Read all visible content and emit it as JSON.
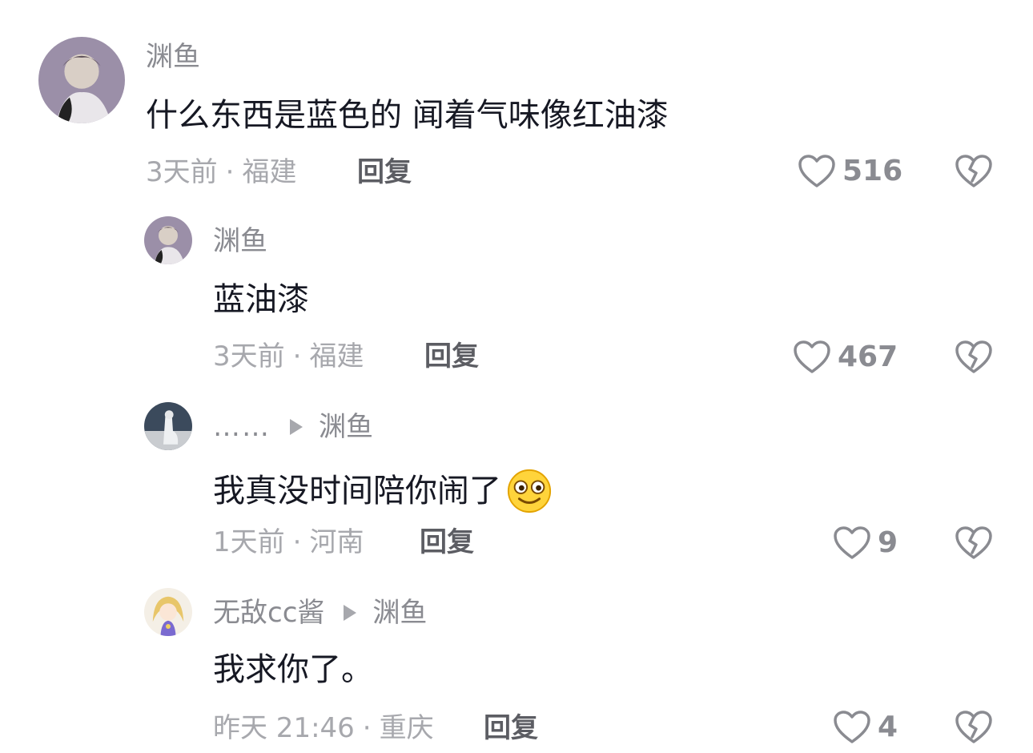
{
  "comments": [
    {
      "author": "渊鱼",
      "text": "什么东西是蓝色的 闻着气味像红油漆",
      "time": "3天前",
      "location": "福建",
      "reply_label": "回复",
      "likes": "516"
    },
    {
      "author": "渊鱼",
      "text": "蓝油漆",
      "time": "3天前",
      "location": "福建",
      "reply_label": "回复",
      "likes": "467"
    },
    {
      "author": "……",
      "reply_to": "渊鱼",
      "text": "我真没时间陪你闹了",
      "emoji": "smile-emoji",
      "time": "1天前",
      "location": "河南",
      "reply_label": "回复",
      "likes": "9"
    },
    {
      "author": "无敌cc酱",
      "reply_to": "渊鱼",
      "text": "我求你了。",
      "time": "昨天 21:46",
      "location": "重庆",
      "reply_label": "回复",
      "likes": "4"
    }
  ],
  "separator": "·",
  "icons": {
    "like": "heart-outline-icon",
    "dislike": "broken-heart-icon",
    "reply_arrow": "triangle-right-icon"
  },
  "colors": {
    "text": "#161823",
    "author": "#8a8b91",
    "meta": "#a7a8ad",
    "reply": "#5c5d63"
  }
}
